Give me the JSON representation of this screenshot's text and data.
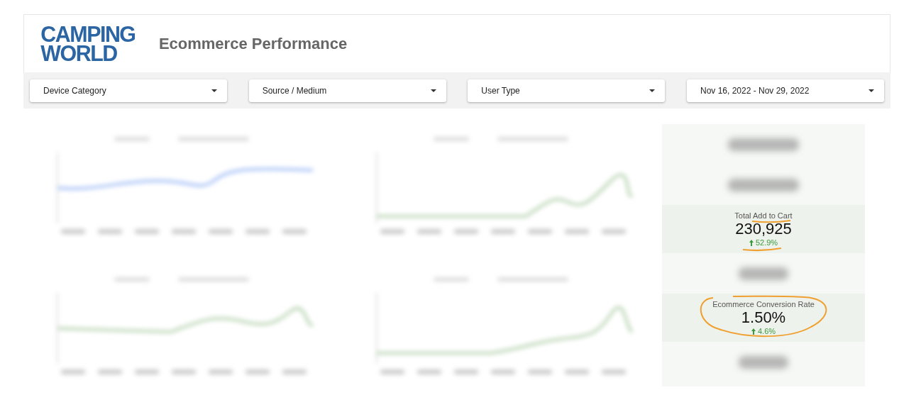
{
  "header": {
    "logo": [
      "CAMPING",
      "WORLD"
    ],
    "title": "Ecommerce Performance"
  },
  "filters": [
    {
      "label": "Device Category"
    },
    {
      "label": "Source / Medium"
    },
    {
      "label": "User Type"
    },
    {
      "label": "Nov 16, 2022 - Nov 29, 2022"
    }
  ],
  "charts": [
    {
      "kind": "blue"
    },
    {
      "kind": "green"
    },
    {
      "kind": "green"
    },
    {
      "kind": "green"
    }
  ],
  "scorecards": [
    {
      "kind": "blurred"
    },
    {
      "kind": "blurred"
    },
    {
      "kind": "metric",
      "label": "Total Add to Cart",
      "value": "230,925",
      "change": "52.9%",
      "underlined": true
    },
    {
      "kind": "blurred"
    },
    {
      "kind": "metric",
      "label": "Ecommerce Conversion Rate",
      "value": "1.50%",
      "change": "4.6%",
      "circled": true
    },
    {
      "kind": "blurred"
    }
  ]
}
